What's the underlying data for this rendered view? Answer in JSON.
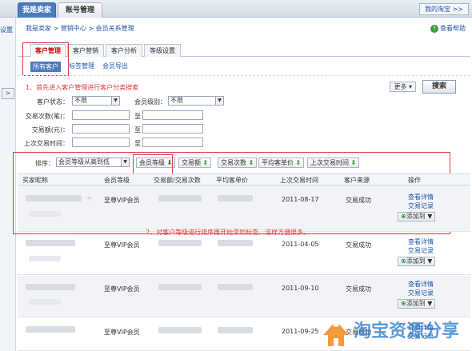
{
  "top": {
    "tabs": [
      "我是卖家",
      "账号管理"
    ],
    "my_taobao": "我的淘宝 >>"
  },
  "left": {
    "label": "设置",
    "arrow": ">"
  },
  "breadcrumb": "我是卖家 > 营销中心 > 会员关系管理",
  "help": "查看帮助",
  "main_tabs": [
    "客户管理",
    "客户营销",
    "客户分析",
    "等级设置"
  ],
  "sub_tabs": [
    "所有客户",
    "标签管理",
    "会员导出"
  ],
  "annot1": "1、首先进入客户管理进行客户分类搜索",
  "annot1_prefix": "1、首先进入",
  "annot_hidden": "客户管理",
  "filters": {
    "status_label": "客户状态：",
    "status_value": "不限",
    "level_label": "会员级别：",
    "level_value": "不限",
    "count_label": "交易次数(笔)：",
    "amount_label": "交易额(元)：",
    "last_label": "上次交易时间：",
    "to": "至"
  },
  "more": "更多",
  "search": "搜索",
  "sort": {
    "label": "排序：",
    "select": "会员等级从高到低",
    "buttons": [
      "会员等级",
      "交易额",
      "交易次数",
      "平均客单价",
      "上次交易时间"
    ]
  },
  "table": {
    "headers": [
      "买家昵称",
      "会员等级",
      "交易额/交易次数",
      "平均客单价",
      "上次交易时间",
      "客户来源",
      "操作"
    ],
    "rows": [
      {
        "level": "至尊VIP会员",
        "date": "2011-08-17",
        "source": "交易成功"
      },
      {
        "level": "至尊VIP会员",
        "date": "2011-04-05",
        "source": "交易成功"
      },
      {
        "level": "至尊VIP会员",
        "date": "2011-09-10",
        "source": "交易成功"
      },
      {
        "level": "至尊VIP会员",
        "date": "2011-09-25",
        "source": "交易成功"
      }
    ],
    "op_detail": "查看详情",
    "op_record": "交易记录",
    "op_add": "添加到"
  },
  "annot2": "2、对客户等级进行排序再开始添加标签，这样方便很多。",
  "watermark": "淘宝资源分享"
}
